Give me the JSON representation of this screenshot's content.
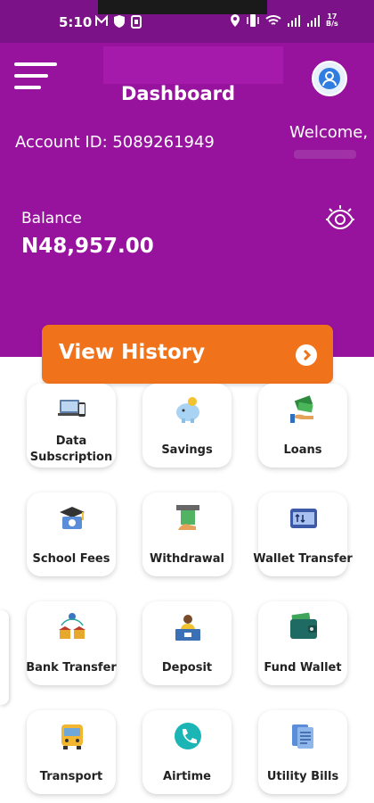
{
  "status_bar": {
    "time": "5:10",
    "battery_top": "17",
    "battery_bottom": "B/s"
  },
  "header": {
    "title": "Dashboard",
    "account_id": "Account ID: 5089261949",
    "welcome": "Welcome,",
    "balance_label": "Balance",
    "balance_value": "N48,957.00"
  },
  "history_button": {
    "label": "View History"
  },
  "services": [
    {
      "label": "Data Subscription",
      "icon": "laptop-phone-icon"
    },
    {
      "label": "Savings",
      "icon": "piggy-bank-icon"
    },
    {
      "label": "Loans",
      "icon": "cash-hand-icon"
    },
    {
      "label": "School Fees",
      "icon": "graduation-cap-icon"
    },
    {
      "label": "Withdrawal",
      "icon": "atm-cash-icon"
    },
    {
      "label": "Wallet Transfer",
      "icon": "wallet-transfer-icon"
    },
    {
      "label": "Bank Transfer",
      "icon": "bank-icon"
    },
    {
      "label": "Deposit",
      "icon": "cashier-desk-icon"
    },
    {
      "label": "Fund Wallet",
      "icon": "wallet-icon"
    },
    {
      "label": "Transport",
      "icon": "bus-icon"
    },
    {
      "label": "Airtime",
      "icon": "phone-call-icon"
    },
    {
      "label": "Utility Bills",
      "icon": "bill-documents-icon"
    }
  ],
  "colors": {
    "primary": "#97139e",
    "status_bar": "#7c1287",
    "accent": "#f0731c"
  }
}
